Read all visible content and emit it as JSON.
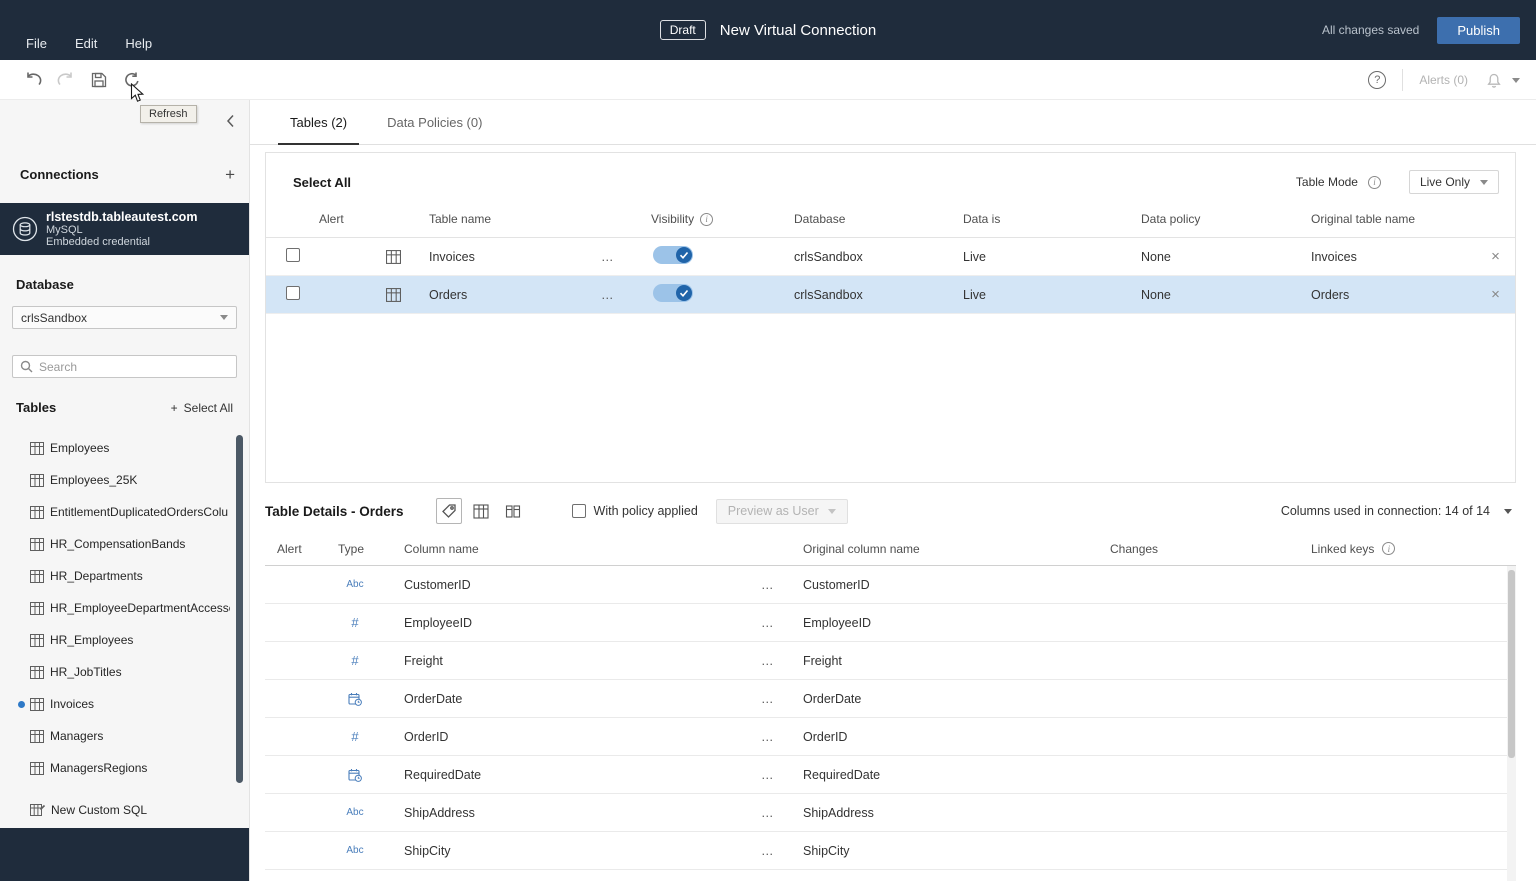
{
  "colors": {
    "topbar_bg": "#1f2c3c",
    "publish_blue": "#3d6fae",
    "selected_row": "#d3e5f6",
    "toggle_track": "#9cc3e8",
    "toggle_knob": "#2064a9",
    "active_dot": "#2e79c7",
    "type_icon_blue": "#4a7ebb"
  },
  "ui": {
    "plus": "+",
    "ellipsis": "…",
    "close": "×",
    "help": "?",
    "info": "i",
    "abc": "Abc",
    "hash": "#"
  },
  "topbar": {
    "menus": [
      {
        "label": "File"
      },
      {
        "label": "Edit"
      },
      {
        "label": "Help"
      }
    ],
    "draft_badge": "Draft",
    "title": "New Virtual Connection",
    "status": "All changes saved",
    "publish_label": "Publish"
  },
  "toolbar": {
    "refresh_tooltip": "Refresh",
    "alerts_label": "Alerts (0)"
  },
  "sidebar": {
    "connections_title": "Connections",
    "connection": {
      "host": "rlstestdb.tableautest.com",
      "type": "MySQL",
      "credential": "Embedded credential"
    },
    "database_label": "Database",
    "database_value": "crlsSandbox",
    "search_placeholder": "Search",
    "tables_title": "Tables",
    "select_all_label": "Select All",
    "tables": [
      {
        "name": "Employees",
        "active": false
      },
      {
        "name": "Employees_25K",
        "active": false
      },
      {
        "name": "EntitlementDuplicatedOrdersColu",
        "active": false
      },
      {
        "name": "HR_CompensationBands",
        "active": false
      },
      {
        "name": "HR_Departments",
        "active": false
      },
      {
        "name": "HR_EmployeeDepartmentAccesse",
        "active": false
      },
      {
        "name": "HR_Employees",
        "active": false
      },
      {
        "name": "HR_JobTitles",
        "active": false
      },
      {
        "name": "Invoices",
        "active": true
      },
      {
        "name": "Managers",
        "active": false
      },
      {
        "name": "ManagersRegions",
        "active": false
      }
    ],
    "new_custom_sql": "New Custom SQL"
  },
  "main": {
    "tabs": [
      {
        "label": "Tables (2)"
      },
      {
        "label": "Data Policies (0)"
      }
    ],
    "tables_panel": {
      "select_all": "Select All",
      "table_mode_label": "Table Mode",
      "table_mode_value": "Live Only",
      "columns": [
        "Alert",
        "Table name",
        "Visibility",
        "Database",
        "Data is",
        "Data policy",
        "Original table name"
      ],
      "rows": [
        {
          "name": "Invoices",
          "database": "crlsSandbox",
          "data_is": "Live",
          "policy": "None",
          "original": "Invoices",
          "selected": false
        },
        {
          "name": "Orders",
          "database": "crlsSandbox",
          "data_is": "Live",
          "policy": "None",
          "original": "Orders",
          "selected": true
        }
      ]
    },
    "details_panel": {
      "title": "Table Details - Orders",
      "with_policy_label": "With policy applied",
      "preview_label": "Preview as User",
      "columns_used_label": "Columns used in connection: 14 of 14",
      "columns": [
        "Alert",
        "Type",
        "Column name",
        "Original column name",
        "Changes",
        "Linked keys"
      ],
      "rows": [
        {
          "type": "string",
          "name": "CustomerID",
          "original": "CustomerID"
        },
        {
          "type": "number",
          "name": "EmployeeID",
          "original": "EmployeeID"
        },
        {
          "type": "number",
          "name": "Freight",
          "original": "Freight"
        },
        {
          "type": "datetime",
          "name": "OrderDate",
          "original": "OrderDate"
        },
        {
          "type": "number",
          "name": "OrderID",
          "original": "OrderID"
        },
        {
          "type": "datetime",
          "name": "RequiredDate",
          "original": "RequiredDate"
        },
        {
          "type": "string",
          "name": "ShipAddress",
          "original": "ShipAddress"
        },
        {
          "type": "string",
          "name": "ShipCity",
          "original": "ShipCity"
        }
      ]
    }
  }
}
